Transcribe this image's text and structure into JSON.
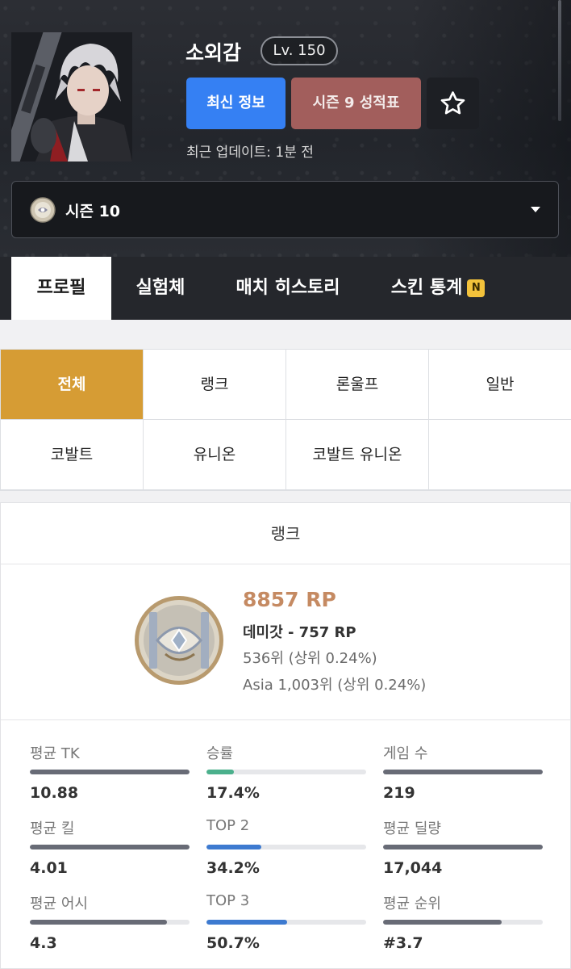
{
  "header": {
    "player_name": "소외감",
    "level": "Lv. 150",
    "buttons": {
      "latest": "최신 정보",
      "season_report": "시즌 9 성적표"
    },
    "update_text": "최근 업데이트: 1분 전",
    "season_select": "시즌 10"
  },
  "nav": {
    "tabs": [
      {
        "label": "프로필",
        "active": true
      },
      {
        "label": "실험체"
      },
      {
        "label": "매치 히스토리"
      },
      {
        "label": "스킨 통계",
        "badge": "N"
      }
    ]
  },
  "modes": [
    {
      "label": "전체",
      "active": true
    },
    {
      "label": "랭크"
    },
    {
      "label": "론울프"
    },
    {
      "label": "일반"
    },
    {
      "label": "코발트"
    },
    {
      "label": "유니온"
    },
    {
      "label": "코발트 유니온"
    },
    {
      "label": ""
    }
  ],
  "rank": {
    "title": "랭크",
    "rp": "8857 RP",
    "tier": "데미갓 - 757 RP",
    "local_rank": "536위 (상위 0.24%)",
    "asia_rank": "Asia 1,003위 (상위 0.24%)"
  },
  "stats": [
    {
      "label": "평균 TK",
      "value": "10.88",
      "fill": 1.0,
      "color": "#686b76"
    },
    {
      "label": "승률",
      "value": "17.4%",
      "fill": 0.174,
      "color": "#4bb08c"
    },
    {
      "label": "게임 수",
      "value": "219",
      "fill": 1.0,
      "color": "#686b76"
    },
    {
      "label": "평균 킬",
      "value": "4.01",
      "fill": 1.0,
      "color": "#686b76"
    },
    {
      "label": "TOP 2",
      "value": "34.2%",
      "fill": 0.342,
      "color": "#3d7ad0"
    },
    {
      "label": "평균 딜량",
      "value": "17,044",
      "fill": 1.0,
      "color": "#686b76"
    },
    {
      "label": "평균 어시",
      "value": "4.3",
      "fill": 0.86,
      "color": "#686b76"
    },
    {
      "label": "TOP 3",
      "value": "50.7%",
      "fill": 0.507,
      "color": "#3d7ad0"
    },
    {
      "label": "평균 순위",
      "value": "#3.7",
      "fill": 0.74,
      "color": "#686b76"
    }
  ]
}
